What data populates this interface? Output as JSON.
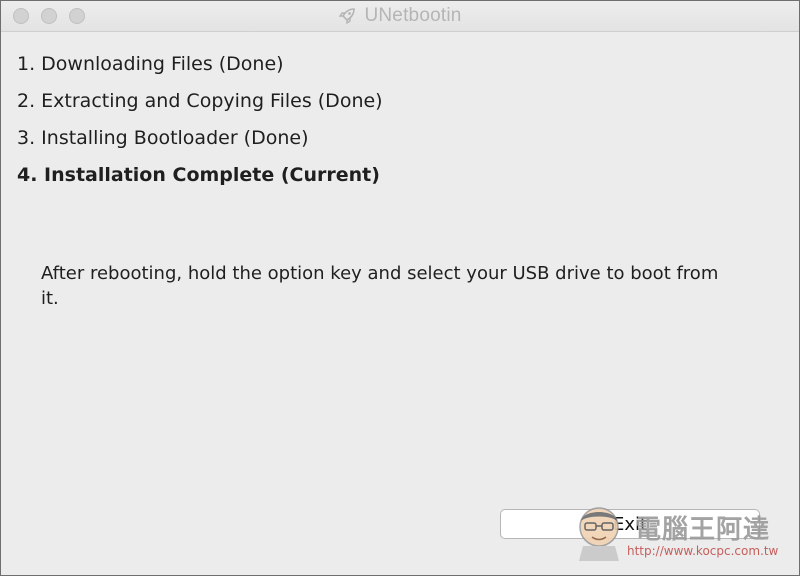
{
  "window": {
    "title": "UNetbootin"
  },
  "steps": [
    {
      "label": "1. Downloading Files (Done)",
      "current": false
    },
    {
      "label": "2. Extracting and Copying Files (Done)",
      "current": false
    },
    {
      "label": "3. Installing Bootloader (Done)",
      "current": false
    },
    {
      "label": "4. Installation Complete (Current)",
      "current": true
    }
  ],
  "message": "After rebooting, hold the option key and select your USB drive to boot from it.",
  "buttons": {
    "exit_label": "Exit"
  },
  "watermark": {
    "brand": "電腦王阿達",
    "url": "http://www.kocpc.com.tw"
  },
  "icons": {
    "title": "rocket-icon",
    "watermark": "mascot-icon"
  },
  "colors": {
    "window_bg": "#ececec",
    "title_text": "#b5b5b5",
    "body_text": "#1f1f1f",
    "button_bg": "#ffffff",
    "watermark_url": "#c0504d"
  }
}
